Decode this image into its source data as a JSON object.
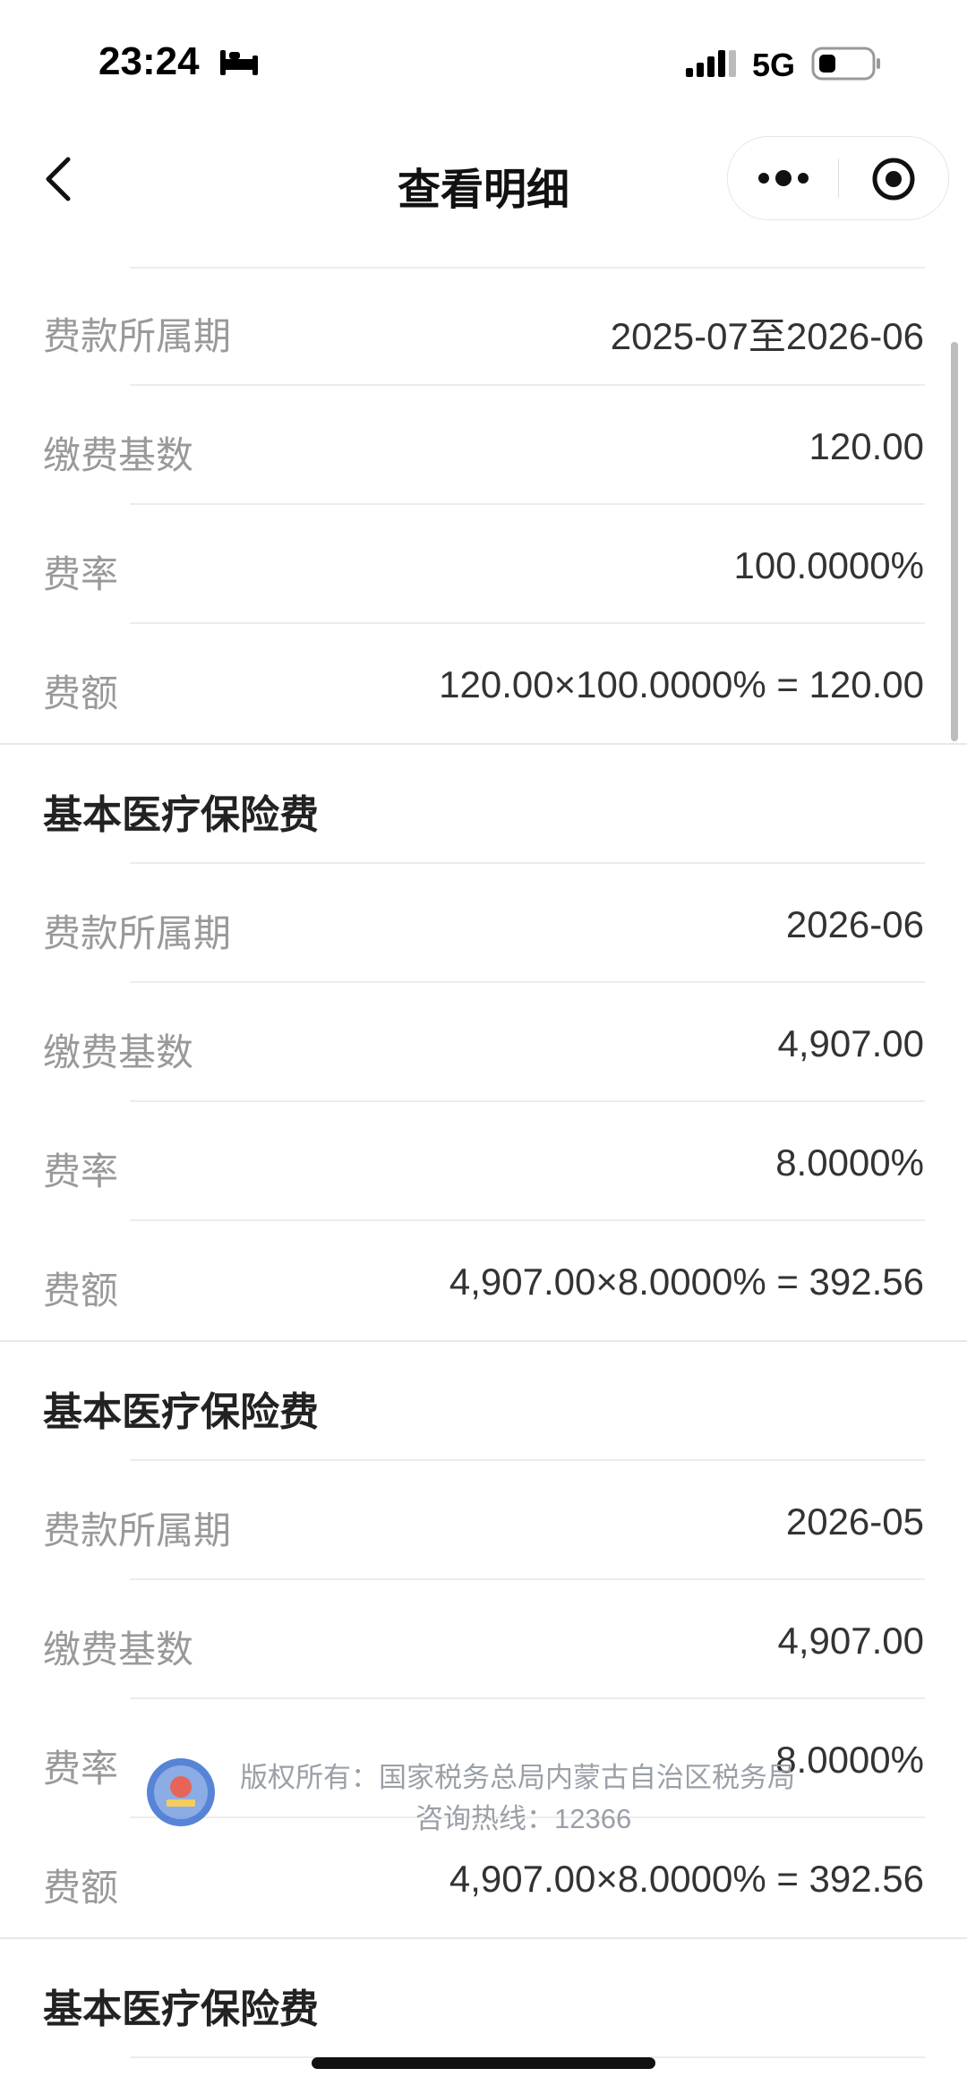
{
  "status_bar": {
    "time": "23:24",
    "network": "5G"
  },
  "nav": {
    "title": "查看明细"
  },
  "groups": [
    {
      "title": "",
      "rows": [
        {
          "label": "费款所属期",
          "value": "2025-07至2026-06"
        },
        {
          "label": "缴费基数",
          "value": "120.00"
        },
        {
          "label": "费率",
          "value": "100.0000%"
        },
        {
          "label": "费额",
          "value": "120.00×100.0000% = 120.00"
        }
      ]
    },
    {
      "title": "基本医疗保险费",
      "rows": [
        {
          "label": "费款所属期",
          "value": "2026-06"
        },
        {
          "label": "缴费基数",
          "value": "4,907.00"
        },
        {
          "label": "费率",
          "value": "8.0000%"
        },
        {
          "label": "费额",
          "value": "4,907.00×8.0000% = 392.56"
        }
      ]
    },
    {
      "title": "基本医疗保险费",
      "rows": [
        {
          "label": "费款所属期",
          "value": "2026-05"
        },
        {
          "label": "缴费基数",
          "value": "4,907.00"
        },
        {
          "label": "费率",
          "value": "8.0000%"
        },
        {
          "label": "费额",
          "value": "4,907.00×8.0000% = 392.56"
        }
      ]
    },
    {
      "title": "基本医疗保险费",
      "rows": []
    }
  ],
  "watermark": {
    "line1": "版权所有：国家税务总局内蒙古自治区税务局",
    "line2": "咨询热线：12366"
  }
}
